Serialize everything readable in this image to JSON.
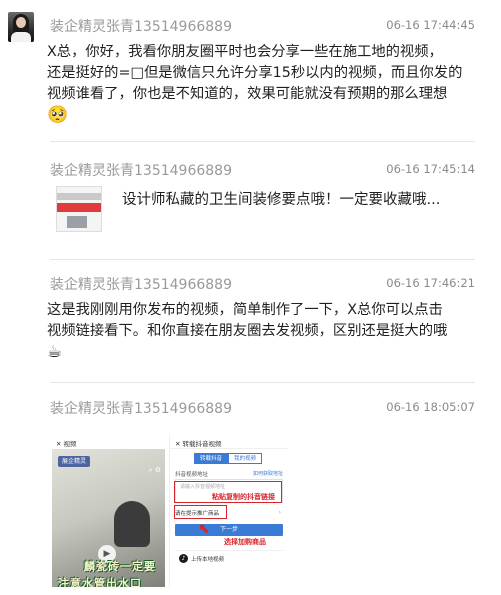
{
  "messages": [
    {
      "sender": "装企精灵张青13514966889",
      "time": "06-16 17:44:45",
      "text_lines": [
        "X总，你好，我看你朋友圈平时也会分享一些在施工地的视频，",
        "还是挺好的=□但是微信只允许分享15秒以内的视频，而且你发的",
        "视频谁看了，你也是不知道的，效果可能就没有预期的那么理想"
      ],
      "emoji": "🥺"
    },
    {
      "sender": "装企精灵张青13514966889",
      "time": "06-16 17:45:14",
      "link_title": "设计师私藏的卫生间装修要点哦！一定要收藏哦..."
    },
    {
      "sender": "装企精灵张青13514966889",
      "time": "06-16 17:46:21",
      "text_lines": [
        "这是我刚刚用你发布的视频，简单制作了一下，X总你可以点击",
        "视频链接看下。和你直接在朋友圈去发视频，区别还是挺大的哦"
      ],
      "emoji": "☕"
    },
    {
      "sender": "装企精灵张青13514966889",
      "time": "06-16 18:05:07",
      "attachment": {
        "left": {
          "title": "视频",
          "chip": "展企精灵",
          "caption1": "麟瓷砖一定要",
          "caption2": "注意水管出水口"
        },
        "right": {
          "title": "转载抖音视频",
          "tab1": "转载抖音",
          "tab2": "我的视频",
          "field_label": "抖音视频地址",
          "field_hint": "如何获取地址",
          "field_placeholder": "请输入抖音视频地址",
          "annot1": "粘贴复制的抖音链接",
          "product_label": "请在提示推广商品",
          "next_button": "下一步",
          "annot2": "选择加购商品",
          "upload_label": "上传本地视频"
        }
      }
    }
  ],
  "colors": {
    "sender": "#9a9a9a",
    "time": "#8a8a8a",
    "text": "#1f1f1f",
    "annotation_red": "#d9252a",
    "app_blue": "#3a7bd5"
  }
}
